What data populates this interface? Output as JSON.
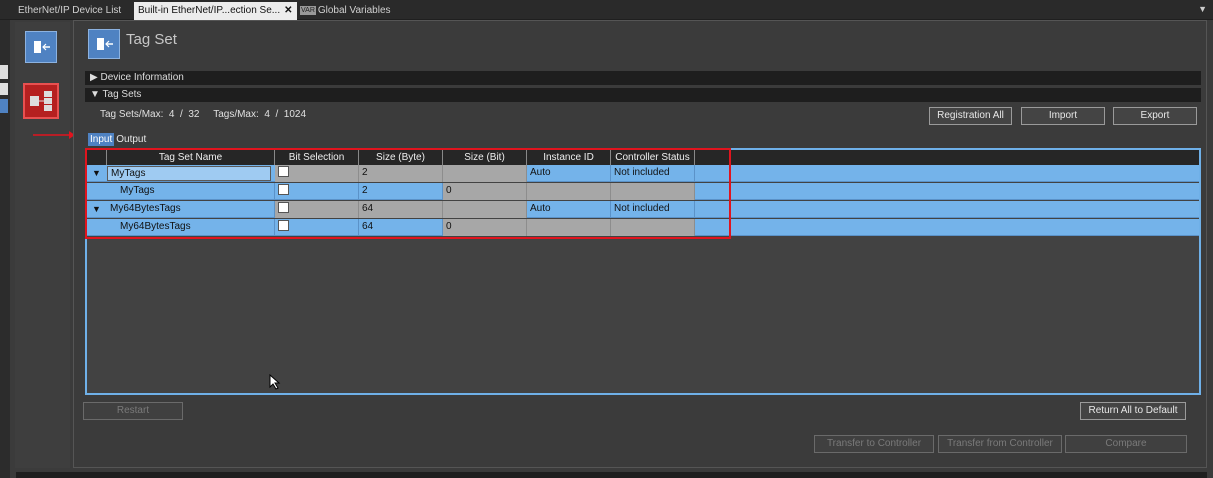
{
  "tabs": [
    {
      "label": "EtherNet/IP Device List",
      "active": false
    },
    {
      "label": "Built-in EtherNet/IP...ection Se...",
      "active": true,
      "close": "✕"
    },
    {
      "label": "Global Variables",
      "active": false,
      "badge": "VAR"
    }
  ],
  "tab_menu": "▼",
  "page": {
    "title": "Tag Set"
  },
  "sections": {
    "device_info": {
      "expander": "▶",
      "label": "Device Information"
    },
    "tag_sets": {
      "expander": "▼",
      "label": "Tag Sets"
    }
  },
  "stats": "Tag Sets/Max:  4  /  32     Tags/Max:  4  /  1024",
  "buttons": {
    "registration_all": "Registration All",
    "import": "Import",
    "export": "Export",
    "restart": "Restart",
    "return_all_default": "Return All to Default",
    "transfer_to_controller": "Transfer to Controller",
    "transfer_from_controller": "Transfer from Controller",
    "compare": "Compare"
  },
  "io_tabs": {
    "input": "Input",
    "output": "Output",
    "selected": "Input"
  },
  "table": {
    "columns": [
      "Tag Set Name",
      "Bit Selection",
      "Size (Byte)",
      "Size (Bit)",
      "Instance ID",
      "Controller Status"
    ],
    "rows": [
      {
        "expander": "▼",
        "name": "MyTags",
        "size_byte": "2",
        "size_bit": "",
        "instance_id": "Auto",
        "status": "Not included"
      },
      {
        "expander": "",
        "name": "MyTags",
        "size_byte": "2",
        "size_bit": "0",
        "instance_id": "",
        "status": ""
      },
      {
        "expander": "▼",
        "name": "My64BytesTags",
        "size_byte": "64",
        "size_bit": "",
        "instance_id": "Auto",
        "status": "Not included"
      },
      {
        "expander": "",
        "name": "My64BytesTags",
        "size_byte": "64",
        "size_bit": "0",
        "instance_id": "",
        "status": ""
      }
    ]
  },
  "colors": {
    "accent": "#4f82c2",
    "row_blue": "#74b3ea",
    "highlight_box": "#e0141e",
    "arrow": "#e0141e"
  },
  "icons": [
    "tag-set-icon",
    "device-network-icon",
    "red-arrow-icon",
    "mouse-cursor-icon"
  ]
}
